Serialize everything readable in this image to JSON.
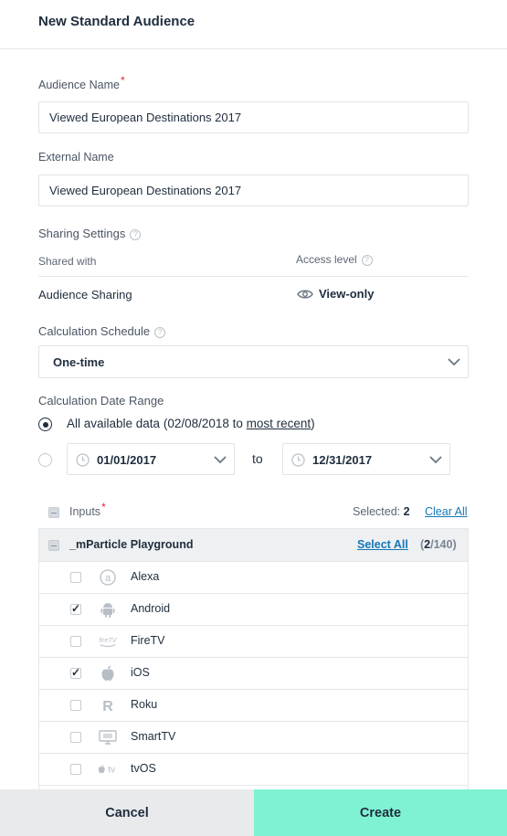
{
  "header": {
    "title": "New Standard Audience"
  },
  "audience_name": {
    "label": "Audience Name",
    "required_mark": "*",
    "value": "Viewed European Destinations 2017"
  },
  "external_name": {
    "label": "External Name",
    "value": "Viewed European Destinations 2017"
  },
  "sharing": {
    "label": "Sharing Settings",
    "help_glyph": "?",
    "shared_with_label": "Shared with",
    "access_level_label": "Access level",
    "row_label": "Audience Sharing",
    "access_value": "View-only"
  },
  "schedule": {
    "label": "Calculation Schedule",
    "help_glyph": "?",
    "selected": "One-time"
  },
  "date_range": {
    "label": "Calculation Date Range",
    "option_all_prefix": "All available data (02/08/2018 to ",
    "option_all_link": "most recent",
    "option_all_suffix": ")",
    "option_all_selected": true,
    "start_date": "01/01/2017",
    "to_label": "to",
    "end_date": "12/31/2017"
  },
  "inputs": {
    "label": "Inputs",
    "required_mark": "*",
    "selected_label": "Selected: ",
    "selected_count": "2",
    "clear_all": "Clear All",
    "group": {
      "name": "_mParticle Playground",
      "select_all": "Select All",
      "count_open": "(",
      "count_selected": "2",
      "count_total": "/140)"
    },
    "items": [
      {
        "name": "Alexa",
        "icon": "alexa-icon",
        "checked": false
      },
      {
        "name": "Android",
        "icon": "android-icon",
        "checked": true
      },
      {
        "name": "FireTV",
        "icon": "firetv-icon",
        "checked": false
      },
      {
        "name": "iOS",
        "icon": "apple-icon",
        "checked": true
      },
      {
        "name": "Roku",
        "icon": "roku-icon",
        "checked": false
      },
      {
        "name": "SmartTV",
        "icon": "smarttv-icon",
        "checked": false
      },
      {
        "name": "tvOS",
        "icon": "appletv-icon",
        "checked": false
      }
    ]
  },
  "footer": {
    "cancel": "Cancel",
    "create": "Create"
  },
  "colors": {
    "create_bg": "#7ff2d3",
    "link": "#1577b5",
    "required": "#e0243a"
  }
}
